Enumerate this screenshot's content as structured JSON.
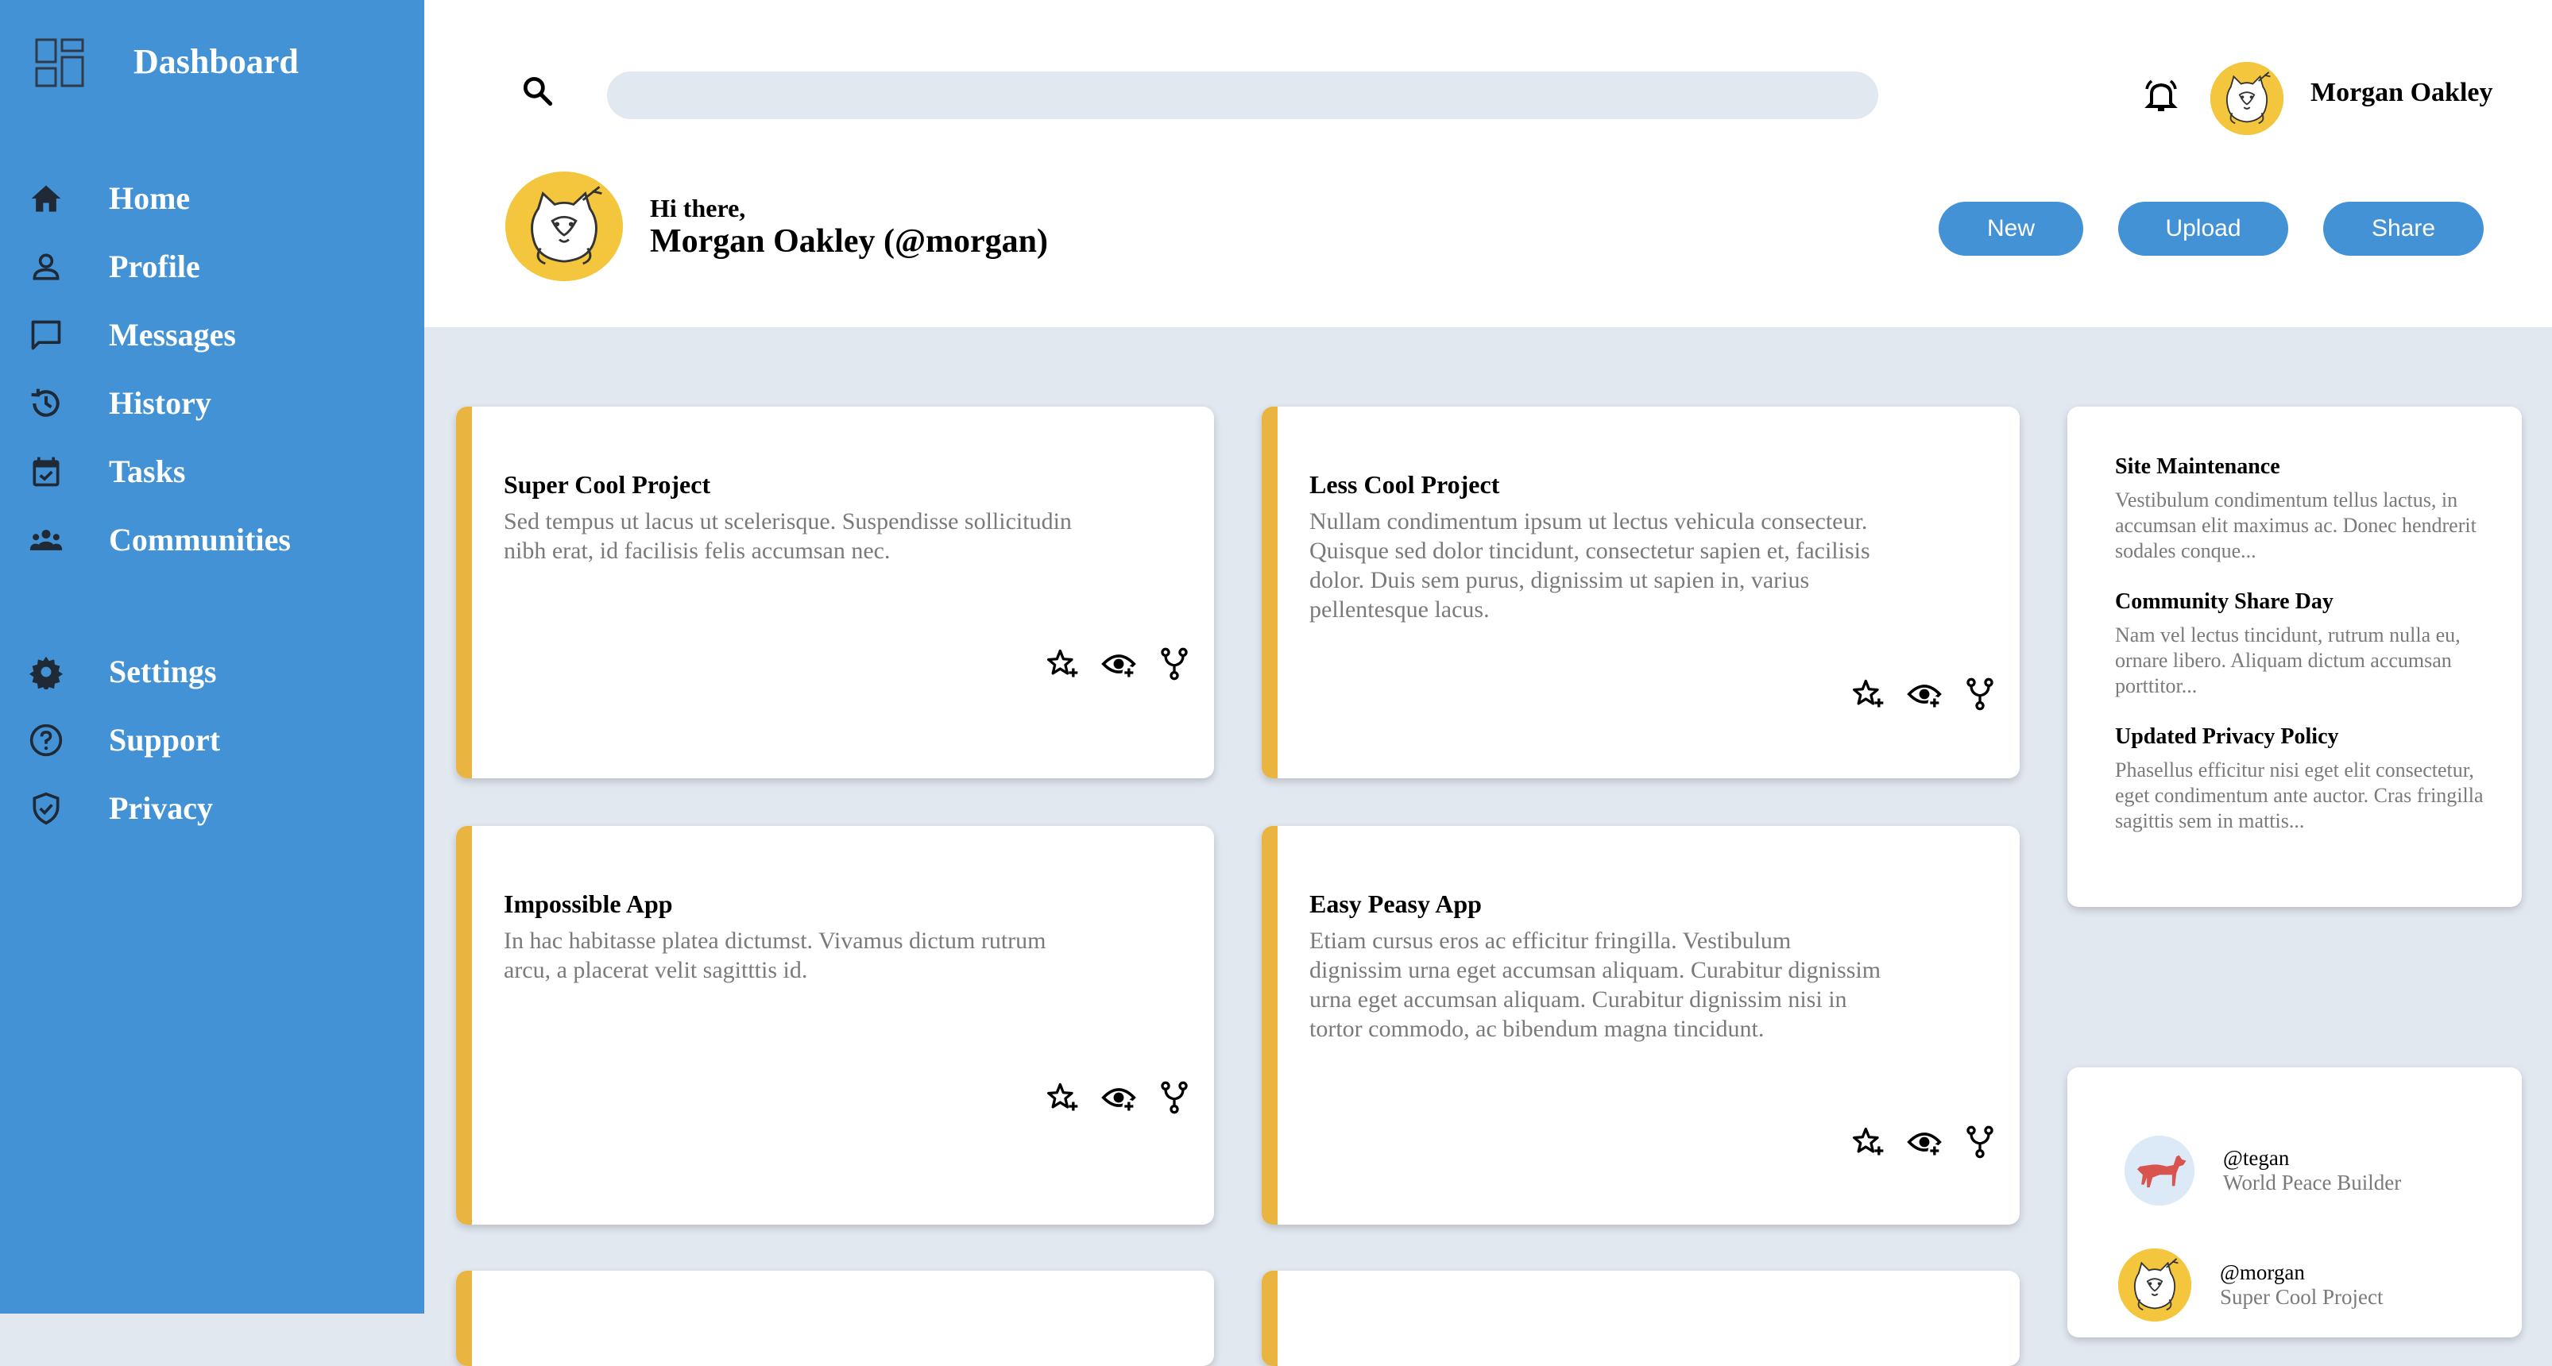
{
  "sidebar": {
    "title": "Dashboard",
    "items": [
      {
        "label": "Home",
        "icon": "home-icon"
      },
      {
        "label": "Profile",
        "icon": "person-icon"
      },
      {
        "label": "Messages",
        "icon": "chat-icon"
      },
      {
        "label": "History",
        "icon": "history-icon"
      },
      {
        "label": "Tasks",
        "icon": "calendar-check-icon"
      },
      {
        "label": "Communities",
        "icon": "groups-icon"
      }
    ],
    "secondary_items": [
      {
        "label": "Settings",
        "icon": "gear-icon"
      },
      {
        "label": "Support",
        "icon": "help-circle-icon"
      },
      {
        "label": "Privacy",
        "icon": "shield-check-icon"
      }
    ]
  },
  "header": {
    "search_placeholder": "",
    "user_name": "Morgan Oakley",
    "greeting_line1": "Hi there,",
    "greeting_line2": "Morgan Oakley (@morgan)",
    "buttons": {
      "new": "New",
      "upload": "Upload",
      "share": "Share"
    }
  },
  "projects": [
    {
      "title": "Super Cool Project",
      "description": "Sed tempus ut lacus ut scelerisque. Suspendisse sollicitudin nibh erat, id facilisis felis accumsan nec."
    },
    {
      "title": "Less Cool Project",
      "description": "Nullam condimentum ipsum ut lectus vehicula consecteur. Quisque sed dolor tincidunt, consectetur sapien et, facilisis dolor. Duis sem purus, dignissim ut sapien in, varius pellentesque lacus."
    },
    {
      "title": "Impossible App",
      "description": "In hac habitasse platea dictumst. Vivamus dictum rutrum arcu, a placerat velit sagitttis id."
    },
    {
      "title": "Easy Peasy App",
      "description": "Etiam cursus eros ac efficitur fringilla. Vestibulum dignissim urna eget accumsan aliquam. Curabitur dignissim urna eget accumsan aliquam. Curabitur dignissim nisi in tortor commodo, ac bibendum magna tincidunt."
    }
  ],
  "announcements": [
    {
      "title": "Site Maintenance",
      "text": "Vestibulum condimentum tellus lactus, in accumsan elit maximus ac. Donec hendrerit sodales conque..."
    },
    {
      "title": "Community Share Day",
      "text": "Nam vel lectus tincidunt, rutrum nulla eu, ornare libero. Aliquam dictum accumsan porttitor..."
    },
    {
      "title": "Updated Privacy Policy",
      "text": "Phasellus efficitur nisi eget elit consectetur, eget condimentum ante auctor. Cras fringilla sagittis sem in mattis..."
    }
  ],
  "trending": [
    {
      "handle": "@tegan",
      "role": "World Peace Builder"
    },
    {
      "handle": "@morgan",
      "role": "Super Cool Project"
    }
  ],
  "colors": {
    "sidebar": "#4392d5",
    "accent": "#e9b440",
    "background": "#e2e8f0"
  }
}
